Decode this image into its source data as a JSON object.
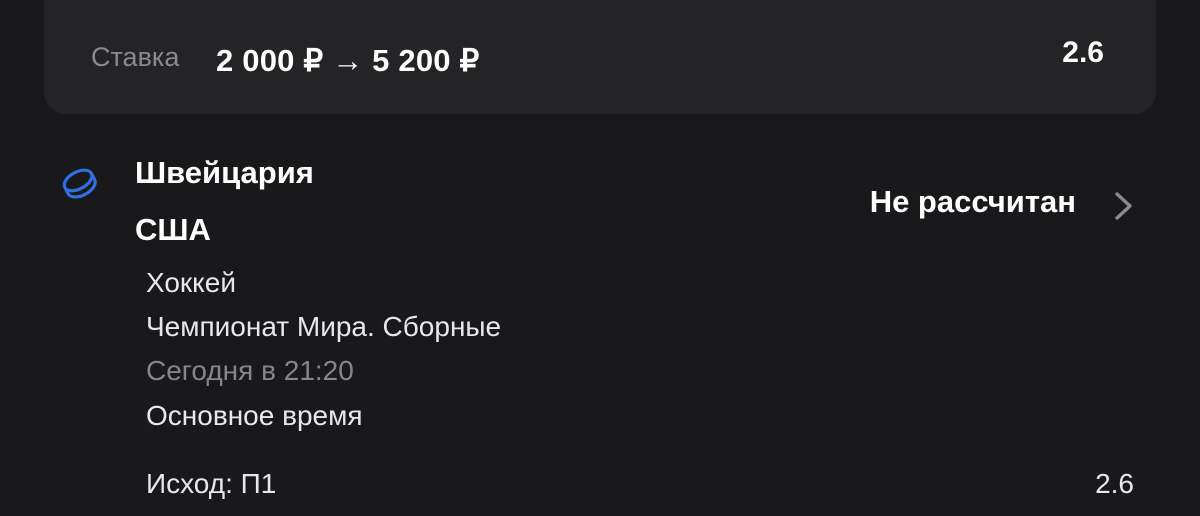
{
  "stake": {
    "label": "Ставка",
    "amount": "2 000 ₽ → 5 200 ₽",
    "odds": "2.6"
  },
  "event": {
    "sport_icon": "hockey-puck-icon",
    "team_home": "Швейцария",
    "team_away": "США",
    "status": "Не рассчитан",
    "sport": "Хоккей",
    "league": "Чемпионат Мира. Сборные",
    "start_time": "Сегодня в 21:20",
    "period": "Основное время"
  },
  "outcome": {
    "label": "Исход: П1",
    "odds": "2.6"
  },
  "colors": {
    "background": "#19191b",
    "card": "#242426",
    "accent": "#2f6fe0",
    "muted_text": "#85858a"
  }
}
